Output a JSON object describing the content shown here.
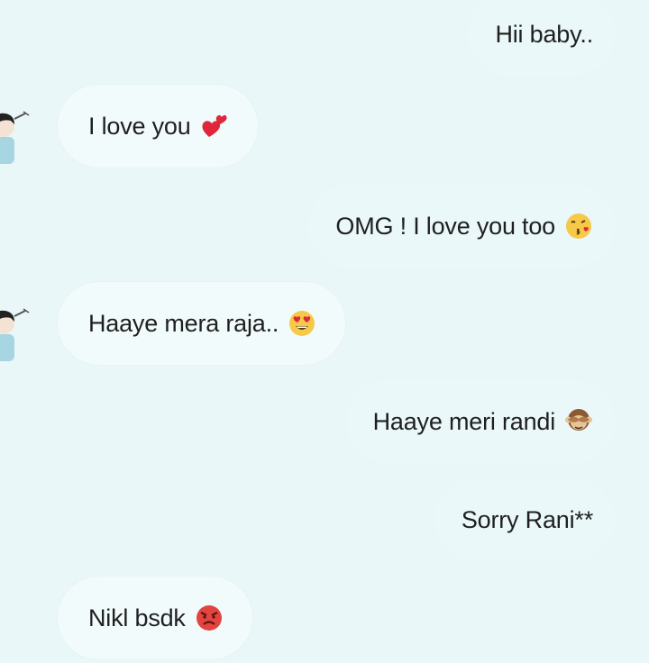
{
  "messages": [
    {
      "id": "m1",
      "side": "out",
      "text": "Hii baby..",
      "emoji": null
    },
    {
      "id": "m2",
      "side": "in",
      "text": "I love you",
      "emoji": "two-hearts-icon"
    },
    {
      "id": "m3",
      "side": "out",
      "text": "OMG ! I love you too",
      "emoji": "kissing-face-icon"
    },
    {
      "id": "m4",
      "side": "in",
      "text": "Haaye mera raja..",
      "emoji": "heart-eyes-face-icon"
    },
    {
      "id": "m5",
      "side": "out",
      "text": "Haaye meri randi",
      "emoji": "see-no-evil-monkey-icon"
    },
    {
      "id": "m6",
      "side": "out",
      "text": "Sorry Rani**",
      "emoji": null
    },
    {
      "id": "m7",
      "side": "in",
      "text": "Nikl bsdk",
      "emoji": "angry-face-icon"
    }
  ],
  "colors": {
    "background": "#e9f7f9",
    "bubble_in": "#f2fbfc",
    "bubble_out": "#eaf8fa",
    "text": "#1f1f1f",
    "heart": "#e0263a",
    "angry": "#e2453f"
  }
}
